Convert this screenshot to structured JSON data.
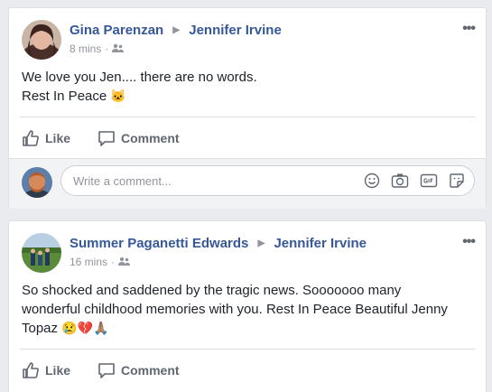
{
  "posts": [
    {
      "author": "Gina Parenzan",
      "target": "Jennifer Irvine",
      "time": "8 mins",
      "dot": "·",
      "more": "•••",
      "text_line1": "We love you Jen.... there are no words.",
      "text_line2": "Rest In Peace",
      "emoji": "🐱",
      "like_label": "Like",
      "comment_label": "Comment",
      "comment_placeholder": "Write a comment..."
    },
    {
      "author": "Summer Paganetti Edwards",
      "target": "Jennifer Irvine",
      "time": "16 mins",
      "dot": "·",
      "more": "•••",
      "text_line1": "So shocked and saddened by the tragic news. Sooooooo many",
      "text_line2": "wonderful childhood memories with you. Rest In Peace Beautiful Jenny",
      "text_line3": "Topaz",
      "emoji": "😢💔🙏🏽",
      "like_label": "Like",
      "comment_label": "Comment"
    }
  ],
  "colors": {
    "author": "#365899",
    "meta": "#90949c",
    "background": "#e9ebee"
  }
}
